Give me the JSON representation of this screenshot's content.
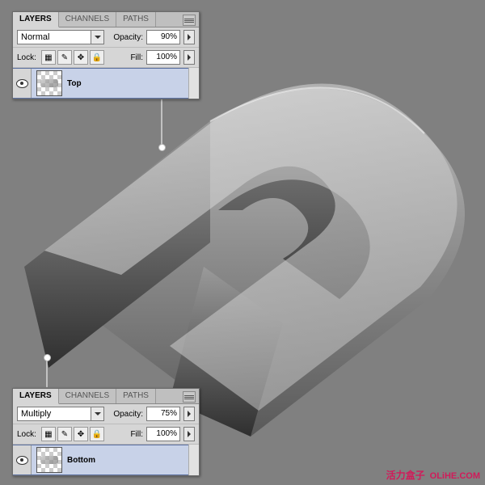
{
  "tabs": {
    "layers": "LAYERS",
    "channels": "CHANNELS",
    "paths": "PATHS"
  },
  "labels": {
    "opacity": "Opacity:",
    "fill": "Fill:",
    "lock": "Lock:"
  },
  "panelTop": {
    "blendMode": "Normal",
    "opacity": "90%",
    "fill": "100%",
    "layerName": "Top"
  },
  "panelBottom": {
    "blendMode": "Multiply",
    "opacity": "75%",
    "fill": "100%",
    "layerName": "Bottom"
  },
  "lockIcons": {
    "transparency": "▦",
    "pixels": "✎",
    "position": "✥",
    "all": "🔒"
  },
  "watermark": {
    "cn": "活力盒子",
    "en": "OLiHE.COM"
  }
}
